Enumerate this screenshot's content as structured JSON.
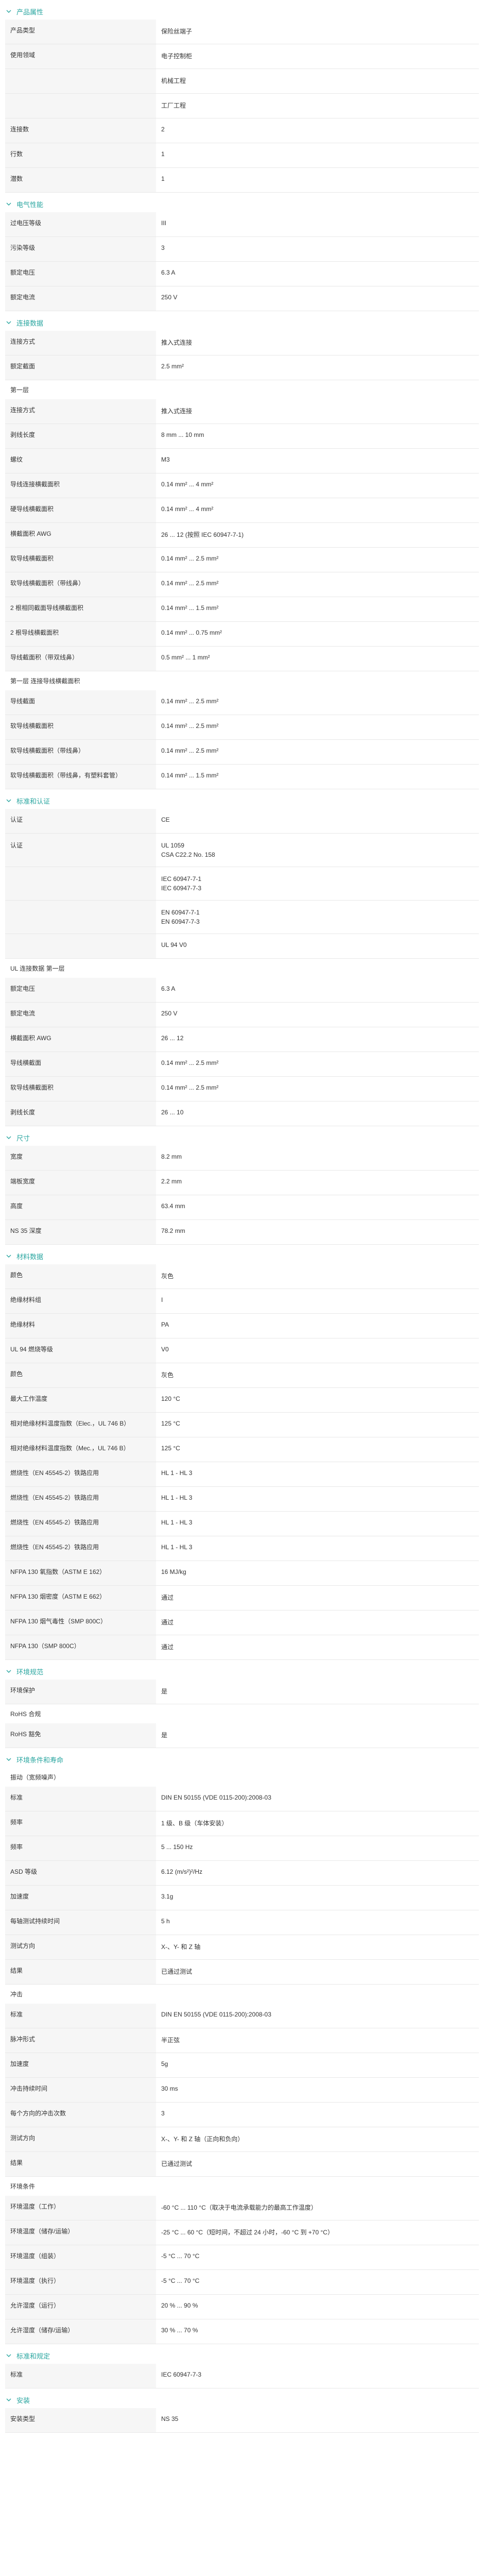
{
  "sections": [
    {
      "title": "产品属性",
      "rows": [
        {
          "label": "产品类型",
          "values": [
            "保险丝端子"
          ]
        },
        {
          "label": "使用领域",
          "values": [
            "电子控制柜"
          ]
        },
        {
          "label": "",
          "values": [
            "机械工程"
          ]
        },
        {
          "label": "",
          "values": [
            "工厂工程"
          ]
        },
        {
          "label": "连接数",
          "values": [
            "2"
          ]
        },
        {
          "label": "行数",
          "values": [
            "1"
          ]
        },
        {
          "label": "潜数",
          "values": [
            "1"
          ]
        }
      ]
    },
    {
      "title": "电气性能",
      "rows": [
        {
          "label": "过电压等级",
          "values": [
            "III"
          ]
        },
        {
          "label": "污染等级",
          "values": [
            "3"
          ]
        }
      ]
    },
    {
      "title": "",
      "rows": [
        {
          "label": "额定电压",
          "values": [
            "6.3 A"
          ]
        },
        {
          "label": "额定电流",
          "values": [
            "250 V"
          ]
        }
      ]
    },
    {
      "title": "连接数据",
      "rows": [
        {
          "label": "连接方式",
          "values": [
            "推入式连接"
          ]
        },
        {
          "label": "额定截面",
          "values": [
            "2.5 mm²"
          ]
        }
      ]
    },
    {
      "title": "",
      "subhead": "第一层",
      "rows": [
        {
          "label": "连接方式",
          "values": [
            "推入式连接"
          ]
        },
        {
          "label": "剥线长度",
          "values": [
            "8 mm ... 10 mm"
          ]
        },
        {
          "label": "螺纹",
          "values": [
            "M3"
          ]
        },
        {
          "label": "导线连接横截面积",
          "values": [
            "0.14 mm² ... 4 mm²"
          ]
        },
        {
          "label": "硬导线横截面积",
          "values": [
            "0.14 mm² ... 4 mm²"
          ]
        },
        {
          "label": "横截面积 AWG",
          "values": [
            "26 ... 12 (按照 IEC 60947-7-1)"
          ]
        },
        {
          "label": "软导线横截面积",
          "values": [
            "0.14 mm² ... 2.5 mm²"
          ]
        },
        {
          "label": "软导线横截面积（带线鼻）",
          "values": [
            "0.14 mm² ... 2.5 mm²"
          ]
        },
        {
          "label": "2 根相同截面导线横截面积",
          "values": [
            "0.14 mm² ... 1.5 mm²"
          ]
        },
        {
          "label": "2 根导线横截面积",
          "values": [
            "0.14 mm² ... 0.75 mm²"
          ]
        },
        {
          "label": "导线截面积（带双线鼻）",
          "values": [
            "0.5 mm² ... 1 mm²"
          ]
        }
      ]
    },
    {
      "title": "",
      "subhead": "第一层 连接导线横截面积",
      "rows": [
        {
          "label": "导线截面",
          "values": [
            "0.14 mm² ... 2.5 mm²"
          ]
        },
        {
          "label": "软导线横截面积",
          "values": [
            "0.14 mm² ... 2.5 mm²"
          ]
        },
        {
          "label": "软导线横截面积（带线鼻）",
          "values": [
            "0.14 mm² ... 2.5 mm²"
          ]
        },
        {
          "label": "软导线横截面积（带线鼻，有塑料套管）",
          "values": [
            "0.14 mm² ... 1.5 mm²"
          ]
        }
      ]
    },
    {
      "title": "标准和认证",
      "rows": [
        {
          "label": "认证",
          "values": [
            "CE"
          ]
        },
        {
          "label": "认证",
          "values": [
            "UL 1059",
            "CSA C22.2 No. 158"
          ]
        },
        {
          "label": "",
          "values": [
            "IEC 60947-7-1",
            "IEC 60947-7-3"
          ]
        },
        {
          "label": "",
          "values": [
            "EN 60947-7-1",
            "EN 60947-7-3"
          ]
        },
        {
          "label": "",
          "values": [
            "UL 94 V0"
          ]
        }
      ]
    },
    {
      "title": "",
      "subhead": "UL 连接数据 第一层",
      "rows": [
        {
          "label": "额定电压",
          "values": [
            "6.3 A"
          ]
        },
        {
          "label": "额定电流",
          "values": [
            "250 V"
          ]
        },
        {
          "label": "横截面积 AWG",
          "values": [
            "26 ... 12"
          ]
        },
        {
          "label": "导线横截面",
          "values": [
            "0.14 mm² ... 2.5 mm²"
          ]
        },
        {
          "label": "软导线横截面积",
          "values": [
            "0.14 mm² ... 2.5 mm²"
          ]
        },
        {
          "label": "剥线长度",
          "values": [
            "26 ... 10"
          ]
        }
      ]
    },
    {
      "title": "尺寸",
      "rows": [
        {
          "label": "宽度",
          "values": [
            "8.2 mm"
          ]
        },
        {
          "label": "端板宽度",
          "values": [
            "2.2 mm"
          ]
        },
        {
          "label": "高度",
          "values": [
            "63.4 mm"
          ]
        },
        {
          "label": "NS 35 深度",
          "values": [
            "78.2 mm"
          ]
        }
      ]
    },
    {
      "title": "材料数据",
      "rows": [
        {
          "label": "颜色",
          "values": [
            "灰色"
          ]
        },
        {
          "label": "绝缘材料组",
          "values": [
            "I"
          ]
        },
        {
          "label": "绝缘材料",
          "values": [
            "PA"
          ]
        },
        {
          "label": "UL 94 燃烧等级",
          "values": [
            "V0"
          ]
        },
        {
          "label": "颜色",
          "values": [
            "灰色"
          ]
        },
        {
          "label": "最大工作温度",
          "values": [
            "120 °C"
          ]
        },
        {
          "label": "相对绝缘材料温度指数（Elec.，UL 746 B）",
          "values": [
            "125 °C"
          ]
        },
        {
          "label": "相对绝缘材料温度指数（Mec.，UL 746 B）",
          "values": [
            "125 °C"
          ]
        },
        {
          "label": "燃烧性（EN 45545-2）铁路应用",
          "values": [
            "HL 1 - HL 3"
          ]
        },
        {
          "label": "燃烧性（EN 45545-2）铁路应用",
          "values": [
            "HL 1 - HL 3"
          ]
        },
        {
          "label": "燃烧性（EN 45545-2）铁路应用",
          "values": [
            "HL 1 - HL 3"
          ]
        },
        {
          "label": "燃烧性（EN 45545-2）铁路应用",
          "values": [
            "HL 1 - HL 3"
          ]
        },
        {
          "label": "NFPA 130 氧指数（ASTM E 162）",
          "values": [
            "16 MJ/kg"
          ]
        },
        {
          "label": "NFPA 130 烟密度（ASTM E 662）",
          "values": [
            "通过"
          ]
        },
        {
          "label": "NFPA 130 烟气毒性（SMP 800C）",
          "values": [
            "通过"
          ]
        },
        {
          "label": "NFPA 130（SMP 800C）",
          "values": [
            "通过"
          ]
        }
      ]
    },
    {
      "title": "环境规范",
      "rows": [
        {
          "label": "环境保护",
          "values": [
            "是"
          ]
        }
      ]
    },
    {
      "title": "",
      "subhead": "RoHS 合规",
      "rows": [
        {
          "label": "RoHS 豁免",
          "values": [
            "是"
          ]
        }
      ]
    },
    {
      "title": "环境条件和寿命",
      "subhead": "振动（宽频噪声）",
      "rows": [
        {
          "label": "标准",
          "values": [
            "DIN EN 50155 (VDE 0115-200):2008-03"
          ]
        },
        {
          "label": "频率",
          "values": [
            "1 级、B 级（车体安装）"
          ]
        },
        {
          "label": "频率",
          "values": [
            "5 ... 150 Hz"
          ]
        },
        {
          "label": "ASD 等级",
          "values": [
            "6.12 (m/s²)²/Hz"
          ]
        },
        {
          "label": "加速度",
          "values": [
            "3.1g"
          ]
        },
        {
          "label": "每轴测试持续时间",
          "values": [
            "5 h"
          ]
        },
        {
          "label": "测试方向",
          "values": [
            "X-、Y- 和 Z 轴"
          ]
        },
        {
          "label": "结果",
          "values": [
            "已通过测试"
          ]
        }
      ]
    },
    {
      "title": "",
      "subhead": "冲击",
      "rows": [
        {
          "label": "标准",
          "values": [
            "DIN EN 50155 (VDE 0115-200):2008-03"
          ]
        },
        {
          "label": "脉冲形式",
          "values": [
            "半正弦"
          ]
        },
        {
          "label": "加速度",
          "values": [
            "5g"
          ]
        },
        {
          "label": "冲击持续时间",
          "values": [
            "30 ms"
          ]
        },
        {
          "label": "每个方向的冲击次数",
          "values": [
            "3"
          ]
        },
        {
          "label": "测试方向",
          "values": [
            "X-、Y- 和 Z 轴（正向和负向）"
          ]
        },
        {
          "label": "结果",
          "values": [
            "已通过测试"
          ]
        }
      ]
    },
    {
      "title": "",
      "subhead": "环境条件",
      "rows": [
        {
          "label": "环境温度（工作）",
          "values": [
            "-60 °C ... 110 °C（取决于电流承载能力的最高工作温度）"
          ]
        },
        {
          "label": "环境温度（储存/运输）",
          "values": [
            "-25 °C ... 60 °C（短时间，不超过 24 小时，-60 °C 到 +70 °C）"
          ]
        },
        {
          "label": "环境温度（组装）",
          "values": [
            "-5 °C ... 70 °C"
          ]
        },
        {
          "label": "环境温度（执行）",
          "values": [
            "-5 °C ... 70 °C"
          ]
        },
        {
          "label": "允许湿度（运行）",
          "values": [
            "20 % ... 90 %"
          ]
        },
        {
          "label": "允许湿度（储存/运输）",
          "values": [
            "30 % ... 70 %"
          ]
        }
      ]
    },
    {
      "title": "标准和规定",
      "rows": [
        {
          "label": "标准",
          "values": [
            "IEC 60947-7-3"
          ]
        }
      ]
    },
    {
      "title": "安装",
      "rows": [
        {
          "label": "安装类型",
          "values": [
            "NS 35"
          ]
        }
      ]
    }
  ]
}
